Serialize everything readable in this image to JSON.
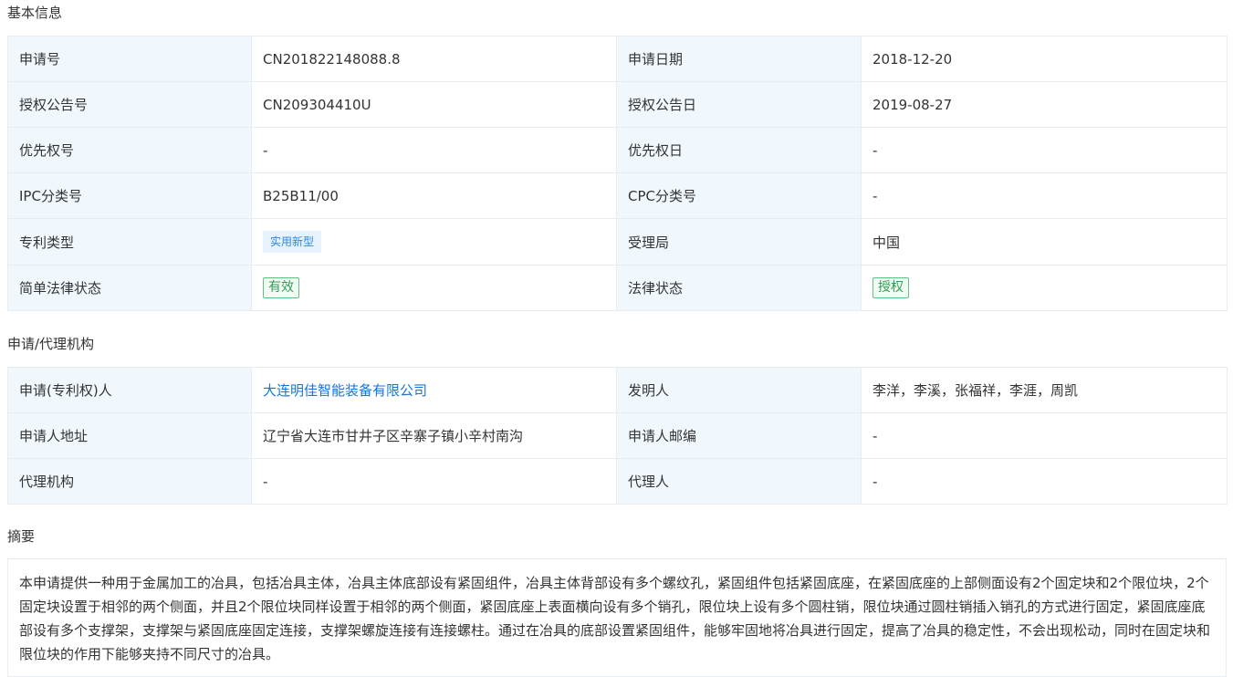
{
  "basic_info": {
    "title": "基本信息",
    "rows": [
      {
        "label1": "申请号",
        "value1": "CN201822148088.8",
        "label2": "申请日期",
        "value2": "2018-12-20"
      },
      {
        "label1": "授权公告号",
        "value1": "CN209304410U",
        "label2": "授权公告日",
        "value2": "2019-08-27"
      },
      {
        "label1": "优先权号",
        "value1": "-",
        "label2": "优先权日",
        "value2": "-"
      },
      {
        "label1": "IPC分类号",
        "value1": "B25B11/00",
        "label2": "CPC分类号",
        "value2": "-"
      },
      {
        "label1": "专利类型",
        "value1": "实用新型",
        "label2": "受理局",
        "value2": "中国"
      },
      {
        "label1": "简单法律状态",
        "value1": "有效",
        "label2": "法律状态",
        "value2": "授权"
      }
    ]
  },
  "agency_info": {
    "title": "申请/代理机构",
    "rows": [
      {
        "label1": "申请(专利权)人",
        "value1": "大连明佳智能装备有限公司",
        "label2": "发明人",
        "value2": "李洋，李溪，张福祥，李涯，周凯"
      },
      {
        "label1": "申请人地址",
        "value1": "辽宁省大连市甘井子区辛寨子镇小辛村南沟",
        "label2": "申请人邮编",
        "value2": "-"
      },
      {
        "label1": "代理机构",
        "value1": "-",
        "label2": "代理人",
        "value2": "-"
      }
    ]
  },
  "abstract": {
    "title": "摘要",
    "text": "本申请提供一种用于金属加工的冶具，包括冶具主体，冶具主体底部设有紧固组件，冶具主体背部设有多个螺纹孔，紧固组件包括紧固底座，在紧固底座的上部侧面设有2个固定块和2个限位块，2个固定块设置于相邻的两个侧面，并且2个限位块同样设置于相邻的两个侧面，紧固底座上表面横向设有多个销孔，限位块上设有多个圆柱销，限位块通过圆柱销插入销孔的方式进行固定，紧固底座底部设有多个支撑架，支撑架与紧固底座固定连接，支撑架螺旋连接有连接螺柱。通过在冶具的底部设置紧固组件，能够牢固地将冶具进行固定，提高了冶具的稳定性，不会出现松动，同时在固定块和限位块的作用下能够夹持不同尺寸的冶具。"
  },
  "colors": {
    "label_bg": "#f1f8fd",
    "border": "#e8ecf1",
    "link": "#1a74d6",
    "tag_blue_bg": "#e6f2fd",
    "tag_blue_text": "#2a8be0",
    "tag_green_border": "#5fc37f",
    "tag_green_text": "#2f9e56"
  }
}
